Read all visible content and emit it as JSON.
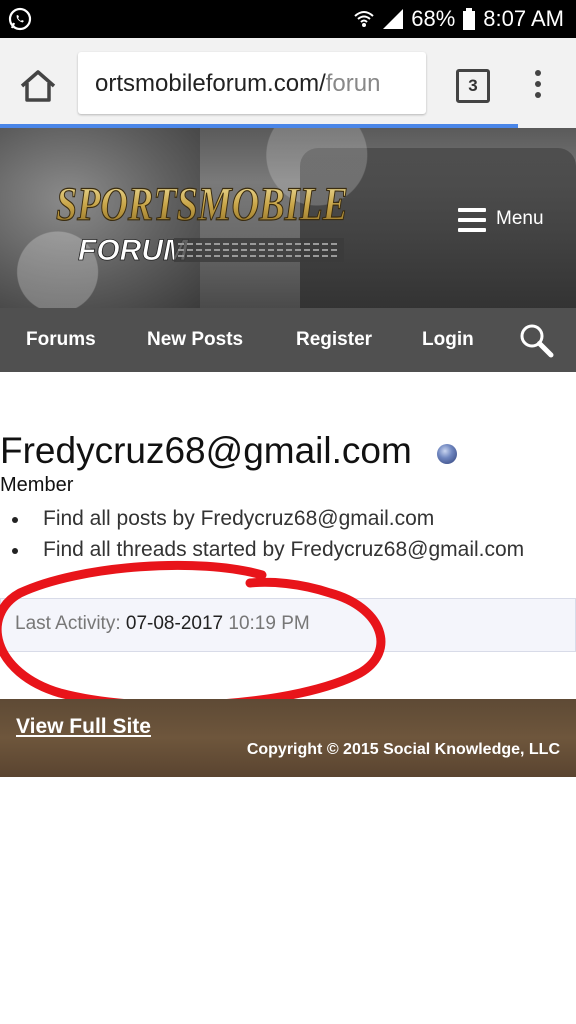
{
  "status_bar": {
    "battery": "68%",
    "time": "8:07 AM"
  },
  "browser": {
    "url_main": "ortsmobileforum.com/",
    "url_dim": "forun",
    "tab_count": "3"
  },
  "header": {
    "menu_label": "Menu"
  },
  "nav": {
    "forums": "Forums",
    "new_posts": "New Posts",
    "register": "Register",
    "login": "Login"
  },
  "profile": {
    "username": "Fredycruz68@gmail.com",
    "role": "Member",
    "links": [
      "Find all posts by Fredycruz68@gmail.com",
      "Find all threads started by Fredycruz68@gmail.com"
    ],
    "last_activity_label": "Last Activity:",
    "last_activity_date": "07-08-2017",
    "last_activity_time": "10:19 PM"
  },
  "footer": {
    "view_full_site": "View Full Site",
    "copyright": "Copyright © 2015 Social Knowledge, LLC"
  },
  "colors": {
    "nav_bg": "#505050",
    "footer_bg": "#6e563c",
    "annotation": "#e8141a",
    "progress": "#4a86e8"
  },
  "icons": [
    "whatsapp-icon",
    "wifi-icon",
    "signal-icon",
    "battery-icon",
    "home-icon",
    "tabs-icon",
    "more-icon",
    "menu-icon",
    "search-icon"
  ]
}
